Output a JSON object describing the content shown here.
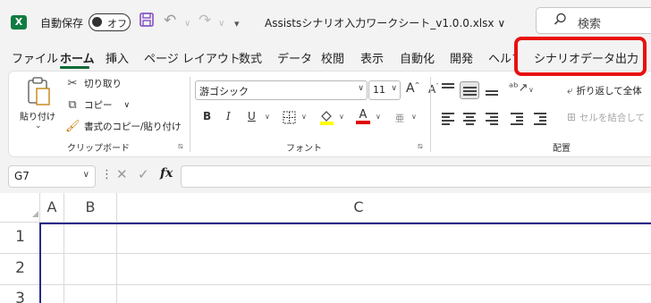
{
  "titlebar": {
    "app_icon": "excel-icon",
    "app_letter": "X",
    "autosave_label": "自動保存",
    "autosave_state": "オフ",
    "filename": "Assistsシナリオ入力ワークシート_v1.0.0.xlsx",
    "filename_chevron": "∨",
    "search_placeholder": "検索"
  },
  "tabs": [
    {
      "label": "ファイル"
    },
    {
      "label": "ホーム",
      "active": true
    },
    {
      "label": "挿入"
    },
    {
      "label": "ページ レイアウト"
    },
    {
      "label": "数式"
    },
    {
      "label": "データ"
    },
    {
      "label": "校閲"
    },
    {
      "label": "表示"
    },
    {
      "label": "自動化"
    },
    {
      "label": "開発"
    },
    {
      "label": "ヘルプ"
    },
    {
      "label": "シナリオデータ出力",
      "highlighted": true
    }
  ],
  "highlight_color": "#e81010",
  "ribbon": {
    "clipboard": {
      "paste_label": "貼り付け",
      "cut_label": "切り取り",
      "copy_label": "コピー",
      "format_painter_label": "書式のコピー/貼り付け",
      "group_label": "クリップボード"
    },
    "font": {
      "font_name": "游ゴシック",
      "font_size": "11",
      "grow_label": "A",
      "shrink_label": "A",
      "bold_label": "B",
      "italic_label": "I",
      "underline_label": "U",
      "font_color_label": "A",
      "phonetic_label": "亜",
      "group_label": "フォント"
    },
    "alignment": {
      "wrap_text_label": "折り返して全体",
      "merge_label": "セルを結合して",
      "group_label": "配置"
    }
  },
  "formula_bar": {
    "name_box": "G7",
    "fx_label": "fx",
    "cancel_icon": "cancel-icon",
    "enter_icon": "check-icon"
  },
  "grid": {
    "columns": [
      "A",
      "B",
      "C"
    ],
    "rows": [
      "1",
      "2",
      "3"
    ]
  },
  "colors": {
    "excel_green": "#107c41",
    "selection_blue": "#2a2a8a",
    "chrome_bg": "#f3f3f3"
  }
}
